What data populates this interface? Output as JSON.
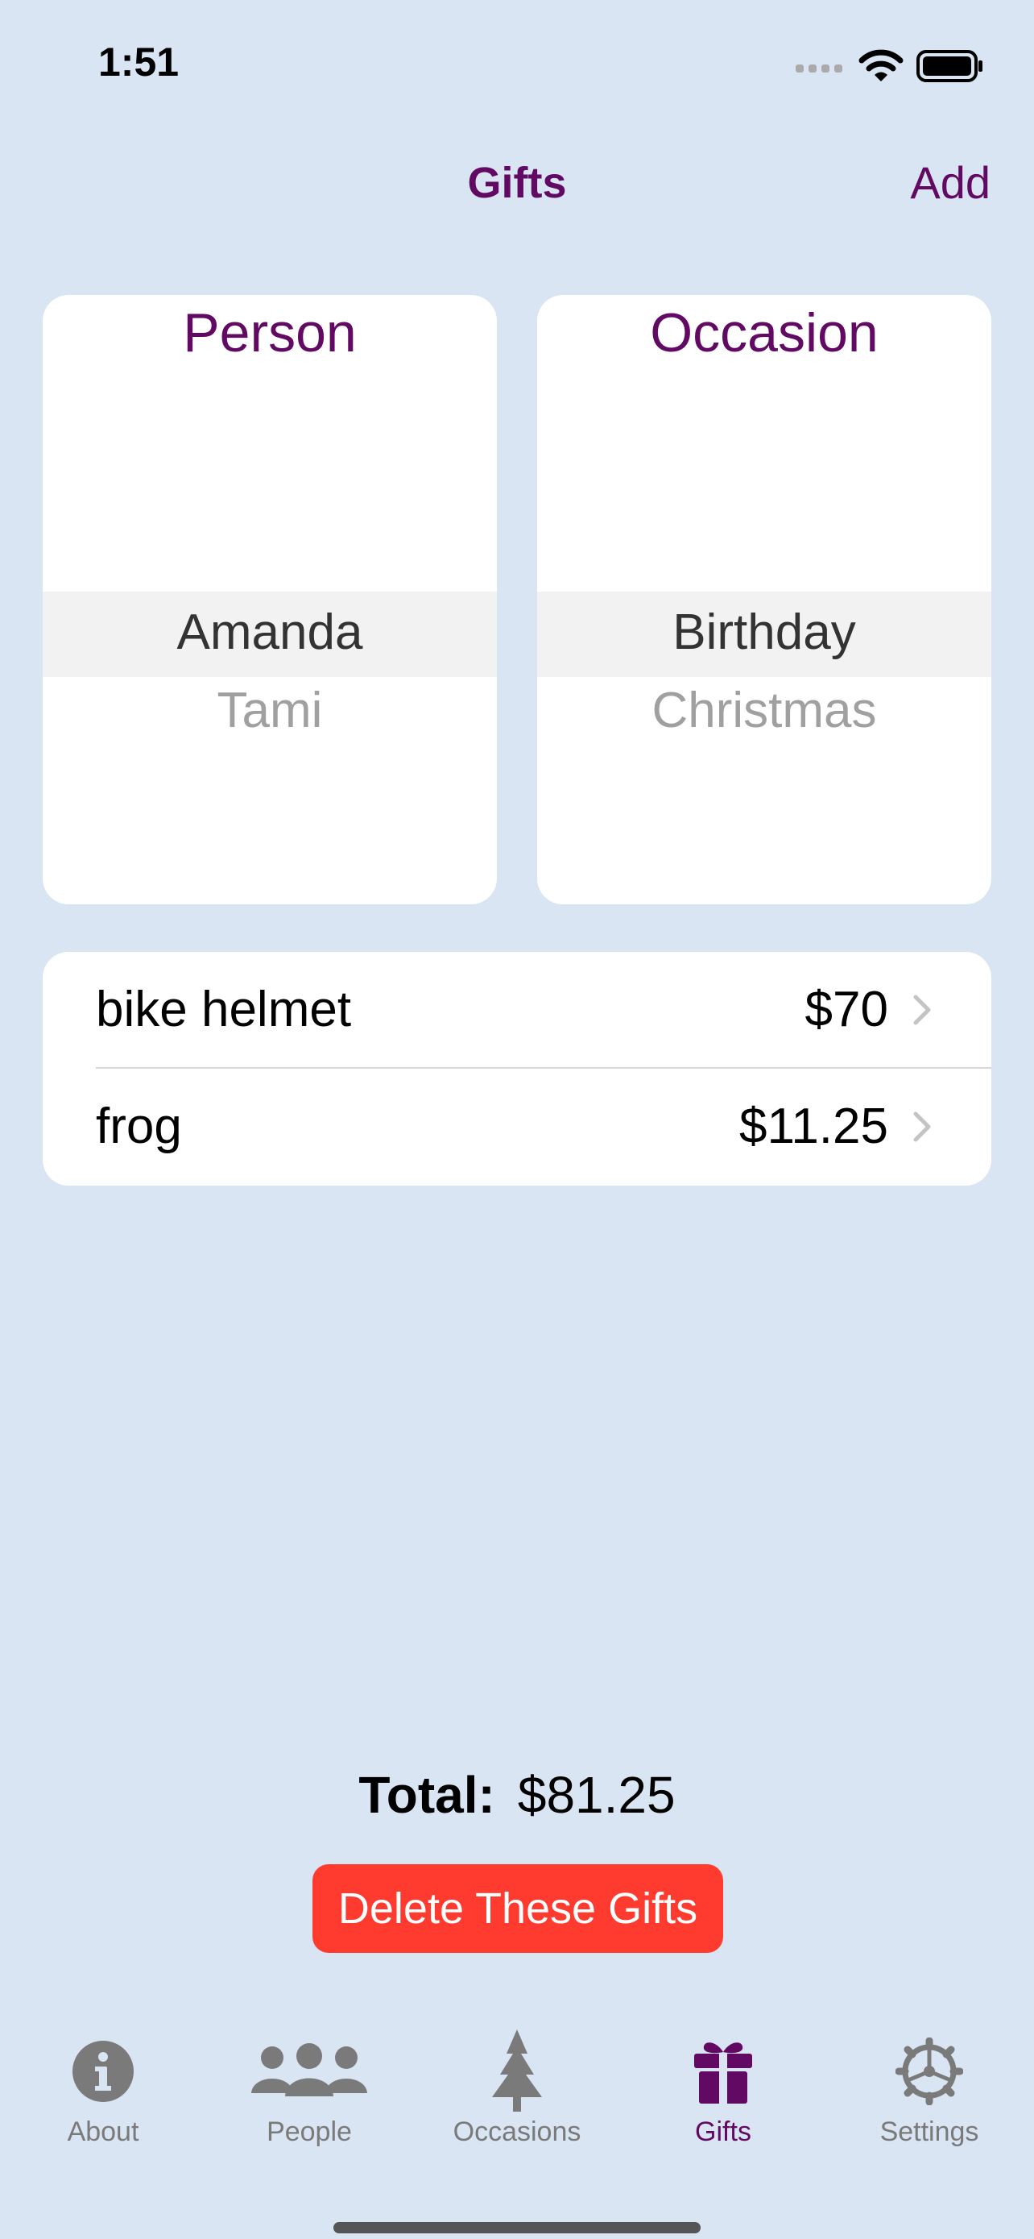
{
  "status_bar": {
    "time": "1:51"
  },
  "nav": {
    "title": "Gifts",
    "add_label": "Add"
  },
  "pickers": {
    "person": {
      "title": "Person",
      "selected": "Amanda",
      "next": "Tami"
    },
    "occasion": {
      "title": "Occasion",
      "selected": "Birthday",
      "next": "Christmas"
    }
  },
  "gifts": [
    {
      "name": "bike helmet",
      "price": "$70"
    },
    {
      "name": "frog",
      "price": "$11.25"
    }
  ],
  "total": {
    "label": "Total:",
    "value": "$81.25"
  },
  "delete_button": "Delete These Gifts",
  "tabs": [
    {
      "label": "About",
      "icon": "info-icon"
    },
    {
      "label": "People",
      "icon": "people-icon"
    },
    {
      "label": "Occasions",
      "icon": "tree-icon"
    },
    {
      "label": "Gifts",
      "icon": "gift-icon",
      "active": true
    },
    {
      "label": "Settings",
      "icon": "gear-icon"
    }
  ],
  "colors": {
    "accent": "#620a63",
    "background": "#d9e5f2",
    "destructive": "#ff3b30",
    "tab_inactive": "#7a7a7a"
  }
}
